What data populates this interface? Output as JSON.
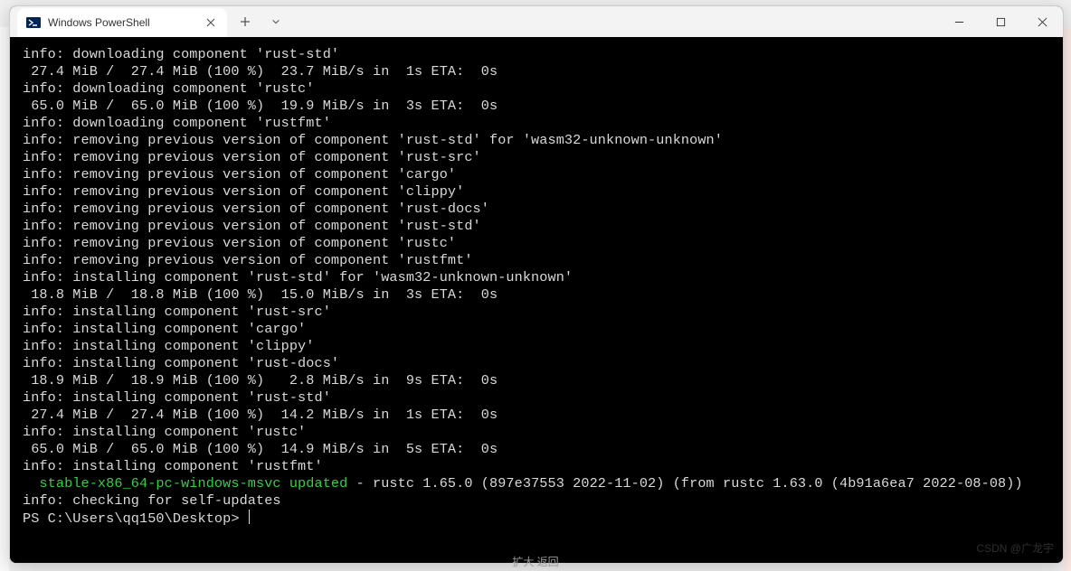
{
  "tab": {
    "title": "Windows PowerShell"
  },
  "lines": [
    {
      "t": "plain",
      "v": "info: downloading component 'rust-std'"
    },
    {
      "t": "plain",
      "v": " 27.4 MiB /  27.4 MiB (100 %)  23.7 MiB/s in  1s ETA:  0s"
    },
    {
      "t": "plain",
      "v": "info: downloading component 'rustc'"
    },
    {
      "t": "plain",
      "v": " 65.0 MiB /  65.0 MiB (100 %)  19.9 MiB/s in  3s ETA:  0s"
    },
    {
      "t": "plain",
      "v": "info: downloading component 'rustfmt'"
    },
    {
      "t": "plain",
      "v": "info: removing previous version of component 'rust-std' for 'wasm32-unknown-unknown'"
    },
    {
      "t": "plain",
      "v": "info: removing previous version of component 'rust-src'"
    },
    {
      "t": "plain",
      "v": "info: removing previous version of component 'cargo'"
    },
    {
      "t": "plain",
      "v": "info: removing previous version of component 'clippy'"
    },
    {
      "t": "plain",
      "v": "info: removing previous version of component 'rust-docs'"
    },
    {
      "t": "plain",
      "v": "info: removing previous version of component 'rust-std'"
    },
    {
      "t": "plain",
      "v": "info: removing previous version of component 'rustc'"
    },
    {
      "t": "plain",
      "v": "info: removing previous version of component 'rustfmt'"
    },
    {
      "t": "plain",
      "v": "info: installing component 'rust-std' for 'wasm32-unknown-unknown'"
    },
    {
      "t": "plain",
      "v": " 18.8 MiB /  18.8 MiB (100 %)  15.0 MiB/s in  3s ETA:  0s"
    },
    {
      "t": "plain",
      "v": "info: installing component 'rust-src'"
    },
    {
      "t": "plain",
      "v": "info: installing component 'cargo'"
    },
    {
      "t": "plain",
      "v": "info: installing component 'clippy'"
    },
    {
      "t": "plain",
      "v": "info: installing component 'rust-docs'"
    },
    {
      "t": "plain",
      "v": " 18.9 MiB /  18.9 MiB (100 %)   2.8 MiB/s in  9s ETA:  0s"
    },
    {
      "t": "plain",
      "v": "info: installing component 'rust-std'"
    },
    {
      "t": "plain",
      "v": " 27.4 MiB /  27.4 MiB (100 %)  14.2 MiB/s in  1s ETA:  0s"
    },
    {
      "t": "plain",
      "v": "info: installing component 'rustc'"
    },
    {
      "t": "plain",
      "v": " 65.0 MiB /  65.0 MiB (100 %)  14.9 MiB/s in  5s ETA:  0s"
    },
    {
      "t": "plain",
      "v": "info: installing component 'rustfmt'"
    },
    {
      "t": "plain",
      "v": ""
    },
    {
      "t": "update",
      "green": "  stable-x86_64-pc-windows-msvc updated",
      "rest": " - rustc 1.65.0 (897e37553 2022-11-02) (from rustc 1.63.0 (4b91a6ea7 2022-08-08))"
    },
    {
      "t": "plain",
      "v": ""
    },
    {
      "t": "plain",
      "v": "info: checking for self-updates"
    },
    {
      "t": "prompt",
      "v": "PS C:\\Users\\qq150\\Desktop> "
    }
  ],
  "watermark": "CSDN @广龙宇",
  "bottom_hint": "扩大 返回"
}
